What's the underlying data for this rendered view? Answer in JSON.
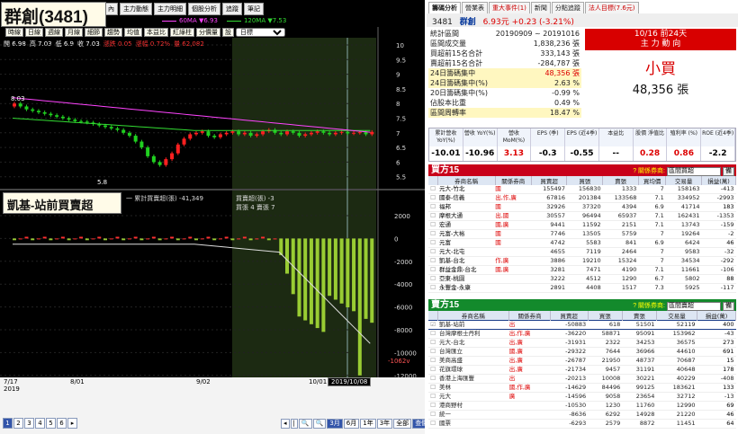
{
  "left": {
    "title": "群創(3481)",
    "top_tabs": [
      "內",
      "主力動態",
      "主力明細",
      "個股分析",
      "追蹤",
      "筆記"
    ],
    "ma": [
      {
        "label": "60MA ▼6.93",
        "color": "#ff44ff"
      },
      {
        "label": "120MA ▼7.53",
        "color": "#33dd33"
      }
    ],
    "toolbar": [
      "時線",
      "日線",
      "週線",
      "月線",
      "細節",
      "趨勢",
      "均值",
      "本益比",
      "紅綠柱",
      "分價量",
      "設"
    ],
    "toolbar_select": "日標",
    "ohlc": [
      "開 6.98",
      "高 7.03",
      "低 6.9",
      "收 7.03",
      "漲跌 0.05",
      "漲幅 0.72%",
      "量 62,082"
    ],
    "price_marks": {
      "high": "8.03",
      "low": "5.8"
    },
    "sub_title": "凱基-站前買賣超",
    "sub_legend": "一 累計買賣超(張) -41,349",
    "sub_legend2_a": "買賣超(張) -3",
    "sub_legend2_b": "買張 4  賣張 7",
    "price_ticks": [
      "10",
      "9.5",
      "9",
      "8.5",
      "8",
      "7.5",
      "7",
      "6.5",
      "6",
      "5.5"
    ],
    "vol_ticks": [
      "2000",
      "0",
      "-2000",
      "-4000",
      "-6000",
      "-8000",
      "-10000",
      "-12000"
    ],
    "vol_current": "-1062v",
    "x_labels": {
      "a": "7/17",
      "a2": "2019",
      "b": "8/01",
      "c": "9/02",
      "d": "10/01",
      "e": "2019/10/08"
    },
    "pager": [
      "1",
      "2",
      "3",
      "4",
      "5",
      "6",
      "▸"
    ],
    "ranges": [
      "◂",
      "|",
      "🔍",
      "🔍",
      "3月",
      "6月",
      "1年",
      "3年",
      "全部",
      "查價"
    ]
  },
  "right": {
    "tabs": [
      {
        "l": "籌碼分析",
        "sel": true
      },
      {
        "l": "營業表"
      },
      {
        "l": "重大事件(1)",
        "red": true
      },
      {
        "l": "新聞"
      },
      {
        "l": "分點追蹤"
      },
      {
        "l": "法人目標(7.6元)",
        "red": true
      }
    ],
    "quote": {
      "code": "3481",
      "name": "群創",
      "price": "6.93元",
      "chg": "+0.23 (-3.21%)"
    },
    "stats": [
      {
        "l": "統計區間",
        "v": "20190909 ~ 20191016"
      },
      {
        "l": "區間成交量",
        "v": "1,838,236 張"
      },
      {
        "l": "買超前15名合計",
        "v": "333,143 張"
      },
      {
        "l": "賣超前15名合計",
        "v": "-284,787 張"
      },
      {
        "l": "24日籌碼集中",
        "v": "48,356 張",
        "hl": true,
        "red": true
      },
      {
        "l": "24日籌碼集中(%)",
        "v": "2.63 %",
        "hl": true
      },
      {
        "l": "20日籌碼集中(%)",
        "v": "-0.99 %"
      },
      {
        "l": "佔股本比重",
        "v": "0.49 %"
      },
      {
        "l": "區間周轉率",
        "v": "18.47 %",
        "hl": true
      }
    ],
    "force_head": [
      "10/16 前24天",
      "主 力 動 向"
    ],
    "force_word": "小買",
    "force_amt": "48,356 張",
    "ratios": [
      {
        "h": "累計營收 YoY(%)",
        "v": "-10.01",
        "c": "blk"
      },
      {
        "h": "營收 YoY(%)",
        "v": "-10.96",
        "c": "blk"
      },
      {
        "h": "營收 MoM(%)",
        "v": "3.13",
        "c": "red"
      },
      {
        "h": "EPS (季)",
        "v": "-0.3",
        "c": "blk"
      },
      {
        "h": "EPS (近4季)",
        "v": "-0.55",
        "c": "blk"
      },
      {
        "h": "本益比",
        "v": "--",
        "c": "blk"
      },
      {
        "h": "股價 淨值比",
        "v": "0.28",
        "c": "red"
      },
      {
        "h": "殖利率 (%)",
        "v": "0.86",
        "c": "red"
      },
      {
        "h": "ROE (近4季)",
        "v": "-2.2",
        "c": "blk"
      }
    ],
    "buy": {
      "title": "買方15",
      "filter_q": "? 關係券商:",
      "filter": "區間買超",
      "btn": "備",
      "cols": [
        "券商名稱",
        "關係券商",
        "買賣超",
        "買張",
        "賣張",
        "買均價",
        "交易量",
        "損益(萬)"
      ],
      "rows": [
        [
          "元大-竹北",
          "國",
          "155497",
          "156830",
          "1333",
          "7",
          "158163",
          "-413"
        ],
        [
          "國泰-信義",
          "出,作,廣",
          "67816",
          "201384",
          "133568",
          "7.1",
          "334952",
          "-2993"
        ],
        [
          "福邦",
          "國",
          "32926",
          "37320",
          "4394",
          "6.9",
          "41714",
          "183"
        ],
        [
          "摩根大通",
          "出,國",
          "30557",
          "96494",
          "65937",
          "7.1",
          "162431",
          "-1353"
        ],
        [
          "宏通",
          "國,廣",
          "9441",
          "11592",
          "2151",
          "7.1",
          "13743",
          "-159"
        ],
        [
          "元富-大裕",
          "國",
          "7746",
          "13505",
          "5759",
          "7",
          "19264",
          "-2"
        ],
        [
          "元富",
          "國",
          "4742",
          "5583",
          "841",
          "6.9",
          "6424",
          "46"
        ],
        [
          "元大-北屯",
          "",
          "4655",
          "7119",
          "2464",
          "7",
          "9583",
          "-32"
        ],
        [
          "凱基-台北",
          "作,廣",
          "3886",
          "19210",
          "15324",
          "7",
          "34534",
          "-292"
        ],
        [
          "群益金鼎-台北",
          "國,廣",
          "3281",
          "7471",
          "4190",
          "7.1",
          "11661",
          "-106"
        ],
        [
          "亞東-桃園",
          "",
          "3222",
          "4512",
          "1290",
          "6.7",
          "5802",
          "88"
        ],
        [
          "永豐金-永康",
          "",
          "2891",
          "4408",
          "1517",
          "7.3",
          "5925",
          "-117"
        ]
      ]
    },
    "sell": {
      "title": "賣方15",
      "filter_q": "? 關係券商:",
      "filter": "區間賣超",
      "btn": "備",
      "cols": [
        "券商名稱",
        "關係券商",
        "買賣超",
        "買張",
        "賣張",
        "交易量",
        "損益(萬)"
      ],
      "rows": [
        [
          "凱基-站前",
          "出",
          "-50883",
          "618",
          "51501",
          "52119",
          "400"
        ],
        [
          "台灣摩根士丹利",
          "出,作,廣",
          "-36220",
          "58871",
          "95091",
          "153962",
          "-43"
        ],
        [
          "元大-台北",
          "出,廣",
          "-31931",
          "2322",
          "34253",
          "36575",
          "273"
        ],
        [
          "台灣匯立",
          "國,廣",
          "-29322",
          "7644",
          "36966",
          "44610",
          "691"
        ],
        [
          "美商高盛",
          "出,廣",
          "-26787",
          "21950",
          "48737",
          "70687",
          "15"
        ],
        [
          "花旗環球",
          "出,廣",
          "-21734",
          "9457",
          "31191",
          "40648",
          "178"
        ],
        [
          "香港上海匯豐",
          "出",
          "-20213",
          "10008",
          "30221",
          "40229",
          "-408"
        ],
        [
          "美林",
          "國,作,廣",
          "-14629",
          "84496",
          "99125",
          "183621",
          "133"
        ],
        [
          "元大",
          "廣",
          "-14596",
          "9058",
          "23654",
          "32712",
          "-13"
        ],
        [
          "港商野村",
          "",
          "-10530",
          "1230",
          "11760",
          "12990",
          "69"
        ],
        [
          "統一",
          "",
          "-8636",
          "6292",
          "14928",
          "21220",
          "46"
        ],
        [
          "國票",
          "",
          "-6293",
          "2579",
          "8872",
          "11451",
          "64"
        ]
      ]
    }
  }
}
